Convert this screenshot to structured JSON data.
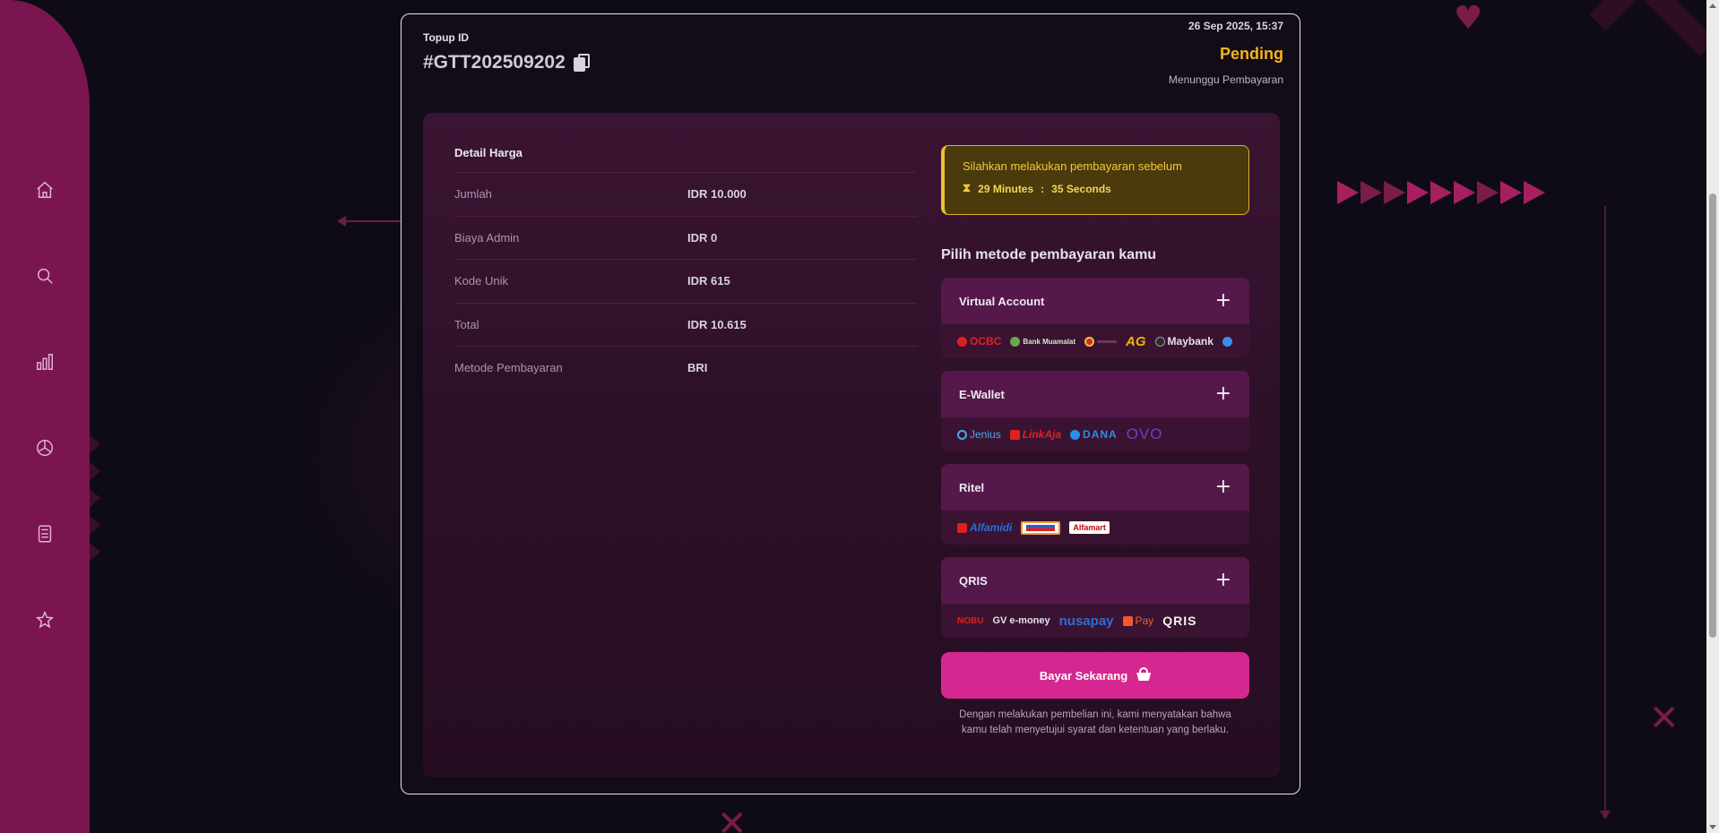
{
  "header": {
    "topup_label": "Topup ID",
    "topup_id": "#GTT202509202",
    "datetime": "26 Sep 2025, 15:37",
    "status": "Pending",
    "status_sub": "Menunggu Pembayaran"
  },
  "price_detail": {
    "title": "Detail Harga",
    "rows": [
      {
        "key": "Jumlah",
        "value": "IDR 10.000"
      },
      {
        "key": "Biaya Admin",
        "value": "IDR 0"
      },
      {
        "key": "Kode Unik",
        "value": "IDR 615"
      },
      {
        "key": "Total",
        "value": "IDR 10.615"
      },
      {
        "key": "Metode Pembayaran",
        "value": "BRI"
      }
    ]
  },
  "warning": {
    "text": "Silahkan melakukan pembayaran sebelum",
    "minutes": "29 Minutes",
    "separator": ":",
    "seconds": "35 Seconds"
  },
  "payment": {
    "title": "Pilih metode pembayaran kamu",
    "methods": [
      {
        "label": "Virtual Account",
        "logos": [
          "OCBC",
          "Bank Muamalat",
          "",
          "AG",
          "Maybank",
          ""
        ]
      },
      {
        "label": "E-Wallet",
        "logos": [
          "Jenius",
          "LinkAja",
          "DANA",
          "OVO"
        ]
      },
      {
        "label": "Ritel",
        "logos": [
          "Alfamidi",
          "",
          "Alfamart"
        ]
      },
      {
        "label": "QRIS",
        "logos": [
          "NOBU",
          "GV e-money",
          "nusapay",
          "Pay",
          "QRIS"
        ]
      }
    ],
    "button_label": "Bayar Sekarang",
    "disclaimer": "Dengan melakukan pembelian ini, kami menyatakan bahwa kamu telah menyetujui syarat dan ketentuan yang berlaku."
  },
  "colors": {
    "accent": "#d4278f",
    "status_pending": "#f2b61a",
    "sidebar": "#7a1550"
  },
  "icons": {
    "nav": [
      "home-icon",
      "search-icon",
      "bar-chart-icon",
      "pie-chart-icon",
      "calculator-icon",
      "star-icon"
    ]
  }
}
